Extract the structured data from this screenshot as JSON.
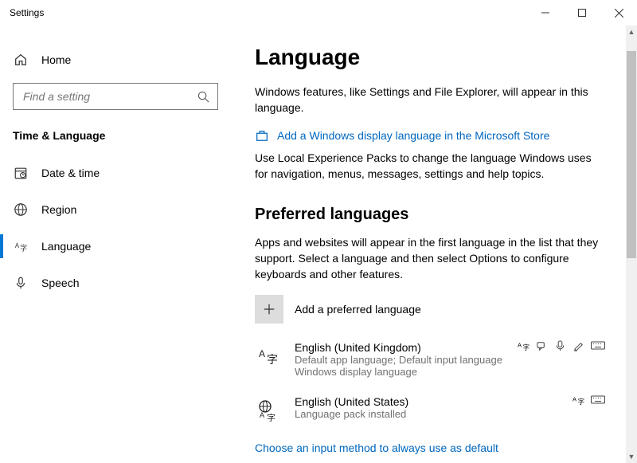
{
  "title": "Settings",
  "sidebar": {
    "home": "Home",
    "search_placeholder": "Find a setting",
    "category": "Time & Language",
    "items": [
      {
        "label": "Date & time"
      },
      {
        "label": "Region"
      },
      {
        "label": "Language"
      },
      {
        "label": "Speech"
      }
    ]
  },
  "main": {
    "heading": "Language",
    "intro": "Windows features, like Settings and File Explorer, will appear in this language.",
    "store_link": "Add a Windows display language in the Microsoft Store",
    "store_desc": "Use Local Experience Packs to change the language Windows uses for navigation, menus, messages, settings and help topics.",
    "pref_heading": "Preferred languages",
    "pref_desc": "Apps and websites will appear in the first language in the list that they support. Select a language and then select Options to configure keyboards and other features.",
    "add_label": "Add a preferred language",
    "langs": [
      {
        "name": "English (United Kingdom)",
        "sub1": "Default app language; Default input language",
        "sub2": "Windows display language"
      },
      {
        "name": "English (United States)",
        "sub1": "Language pack installed",
        "sub2": ""
      }
    ],
    "input_link": "Choose an input method to always use as default"
  }
}
